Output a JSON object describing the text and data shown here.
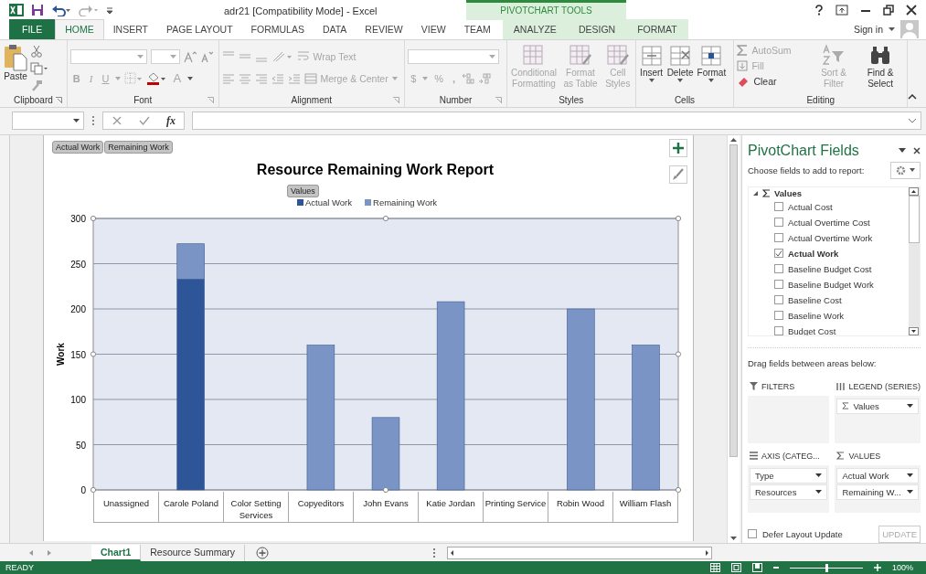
{
  "window": {
    "title": "adr21  [Compatibility Mode] - Excel",
    "contextual_group": "PIVOTCHART TOOLS",
    "sign_in": "Sign in"
  },
  "tabs": [
    {
      "label": "FILE",
      "kind": "file",
      "selected": false
    },
    {
      "label": "HOME",
      "kind": "normal",
      "selected": true
    },
    {
      "label": "INSERT",
      "kind": "normal",
      "selected": false
    },
    {
      "label": "PAGE LAYOUT",
      "kind": "normal",
      "selected": false
    },
    {
      "label": "FORMULAS",
      "kind": "normal",
      "selected": false
    },
    {
      "label": "DATA",
      "kind": "normal",
      "selected": false
    },
    {
      "label": "REVIEW",
      "kind": "normal",
      "selected": false
    },
    {
      "label": "VIEW",
      "kind": "normal",
      "selected": false
    },
    {
      "label": "TEAM",
      "kind": "normal",
      "selected": false
    },
    {
      "label": "ANALYZE",
      "kind": "contextual",
      "selected": false
    },
    {
      "label": "DESIGN",
      "kind": "contextual",
      "selected": false
    },
    {
      "label": "FORMAT",
      "kind": "contextual",
      "selected": false
    }
  ],
  "ribbon": {
    "groups": [
      {
        "label": "Clipboard",
        "commands": [
          {
            "label": "Paste",
            "disabled": false
          }
        ]
      },
      {
        "label": "Font",
        "commands": [
          {
            "label": "B",
            "disabled": true
          },
          {
            "label": "I",
            "disabled": true
          },
          {
            "label": "U",
            "disabled": true
          },
          {
            "label": "A",
            "disabled": true
          }
        ]
      },
      {
        "label": "Alignment",
        "commands": [
          {
            "label": "Wrap Text",
            "disabled": true
          },
          {
            "label": "Merge & Center",
            "disabled": true
          }
        ]
      },
      {
        "label": "Number",
        "commands": [
          {
            "label": "$",
            "disabled": true
          },
          {
            "label": "%",
            "disabled": true
          },
          {
            "label": ",",
            "disabled": true
          }
        ]
      },
      {
        "label": "Styles",
        "commands": [
          {
            "label": "Conditional Formatting",
            "disabled": true
          },
          {
            "label": "Format as Table",
            "disabled": true
          },
          {
            "label": "Cell Styles",
            "disabled": true
          }
        ]
      },
      {
        "label": "Cells",
        "commands": [
          {
            "label": "Insert",
            "disabled": false
          },
          {
            "label": "Delete",
            "disabled": false
          },
          {
            "label": "Format",
            "disabled": false
          }
        ]
      },
      {
        "label": "Editing",
        "commands": [
          {
            "label": "AutoSum",
            "disabled": true
          },
          {
            "label": "Fill",
            "disabled": true
          },
          {
            "label": "Clear",
            "disabled": false
          },
          {
            "label": "Sort & Filter",
            "disabled": true
          },
          {
            "label": "Find & Select",
            "disabled": false
          }
        ]
      }
    ]
  },
  "formula_bar": {
    "function_label": "fx"
  },
  "chart": {
    "field_buttons": [
      "Actual Work",
      "Remaining Work"
    ],
    "legend_field_button": "Values",
    "chart_data": {
      "type": "bar",
      "title": "Resource Remaining Work Report",
      "ylabel": "Work",
      "stacked": true,
      "orientation": "vertical",
      "categories": [
        "Unassigned",
        "Carole Poland",
        "Color Setting Services",
        "Copyeditors",
        "John Evans",
        "Katie Jordan",
        "Printing Service",
        "Robin Wood",
        "William Flash"
      ],
      "ylim": [
        0,
        300
      ],
      "grid": true,
      "yticks": [
        0,
        50,
        100,
        150,
        200,
        250,
        300
      ],
      "series": [
        {
          "name": "Actual Work",
          "color": "#2e5597",
          "values": [
            null,
            233,
            null,
            null,
            null,
            null,
            null,
            null,
            null
          ]
        },
        {
          "name": "Remaining Work",
          "color": "#7b94c6",
          "values": [
            null,
            39,
            null,
            160,
            80,
            208,
            null,
            200,
            160
          ]
        }
      ]
    }
  },
  "sheet_tabs": [
    {
      "label": "Chart1",
      "selected": true
    },
    {
      "label": "Resource Summary",
      "selected": false
    }
  ],
  "status_bar": {
    "status": "READY",
    "zoom": "100%",
    "zoom_slider": {
      "level": 0.5
    }
  },
  "pivot_panel": {
    "title": "PivotChart Fields",
    "subtitle": "Choose fields to add to report:",
    "tree": {
      "label": "Values",
      "expanded": true,
      "children": [
        {
          "label": "Actual Cost",
          "checked": false
        },
        {
          "label": "Actual Overtime Cost",
          "checked": false
        },
        {
          "label": "Actual Overtime Work",
          "checked": false
        },
        {
          "label": "Actual Work",
          "checked": true
        },
        {
          "label": "Baseline Budget Cost",
          "checked": false
        },
        {
          "label": "Baseline Budget Work",
          "checked": false
        },
        {
          "label": "Baseline Cost",
          "checked": false
        },
        {
          "label": "Baseline Work",
          "checked": false
        },
        {
          "label": "Budget Cost",
          "checked": false
        }
      ]
    },
    "drag_hint": "Drag fields between areas below:",
    "areas": [
      {
        "label": "FILTERS",
        "kind": "filters"
      },
      {
        "label": "LEGEND (SERIES)",
        "kind": "legend",
        "items": [
          {
            "label": "Values",
            "sigma": true
          }
        ]
      },
      {
        "label": "AXIS (CATEG...",
        "kind": "axis",
        "items": [
          {
            "label": "Type",
            "sigma": false
          },
          {
            "label": "Resources",
            "sigma": false
          }
        ]
      },
      {
        "label": "VALUES",
        "kind": "values",
        "items": [
          {
            "label": "Actual Work",
            "sigma": false
          },
          {
            "label": "Remaining W...",
            "sigma": false
          }
        ]
      }
    ],
    "defer": {
      "label": "Defer Layout Update",
      "checked": false
    },
    "update_button": {
      "label": "UPDATE",
      "disabled": true
    }
  }
}
